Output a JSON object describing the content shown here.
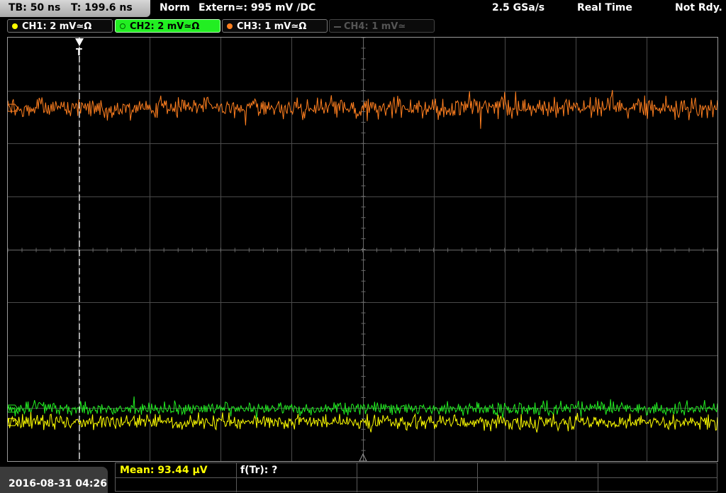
{
  "topbar": {
    "timebase": "TB: 50 ns",
    "trigger_time": "T: 199.6 ns",
    "mode": "Norm",
    "trigger_source": "Extern≃: 995 mV ∕DC",
    "sample_rate": "2.5 GSa/s",
    "acq_mode": "Real Time",
    "status": "Not Rdy."
  },
  "channels": [
    {
      "label": "CH1: 2 mV≃Ω",
      "color": "#ffff00",
      "state": "on"
    },
    {
      "label": "CH2: 2 mV≃Ω",
      "color": "#22ee22",
      "state": "active"
    },
    {
      "label": "CH3: 1 mV≃Ω",
      "color": "#ff7f1f",
      "state": "on"
    },
    {
      "label": "CH4: 1 mV≃",
      "color": "#555555",
      "state": "off"
    }
  ],
  "trigger_marker": "T",
  "colors": {
    "ch1": "#ffff00",
    "ch2": "#22ee22",
    "ch3": "#ff7f1f",
    "grid": "#4a4a4a",
    "background": "#000000"
  },
  "bottombar": {
    "datetime": "2016-08-31 04:26",
    "mean_label": "Mean: 93.44 µV",
    "ftr_label": "f(Tr): ?"
  }
}
